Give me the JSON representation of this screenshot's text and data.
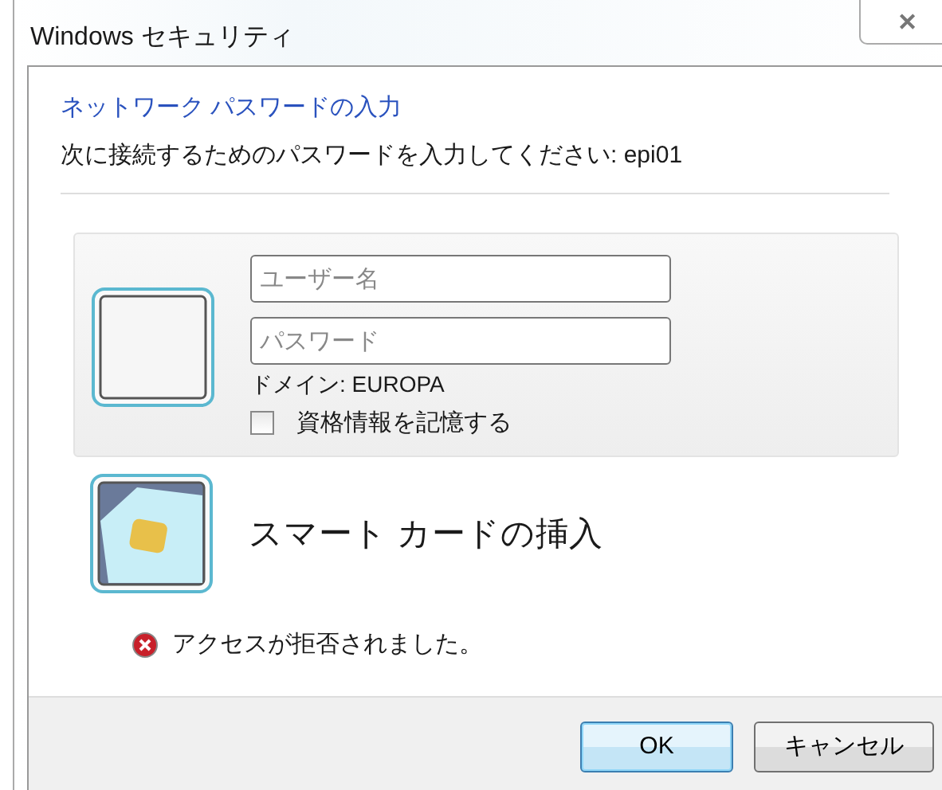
{
  "window": {
    "title": "Windows セキュリティ",
    "close": "✕"
  },
  "heading": "ネットワーク パスワードの入力",
  "instruction": "次に接続するためのパスワードを入力してください: epi01",
  "credential": {
    "username": {
      "placeholder": "ユーザー名"
    },
    "password": {
      "placeholder": "パスワード"
    },
    "domain": "ドメイン: EUROPA",
    "remember": {
      "label": "資格情報を記憶する",
      "checked": false
    }
  },
  "smart_card": {
    "label": "スマート カードの挿入"
  },
  "error": "アクセスが拒否されました。",
  "buttons": [
    {
      "label": "OK",
      "default": true
    },
    {
      "label": "キャンセル",
      "default": false
    }
  ]
}
